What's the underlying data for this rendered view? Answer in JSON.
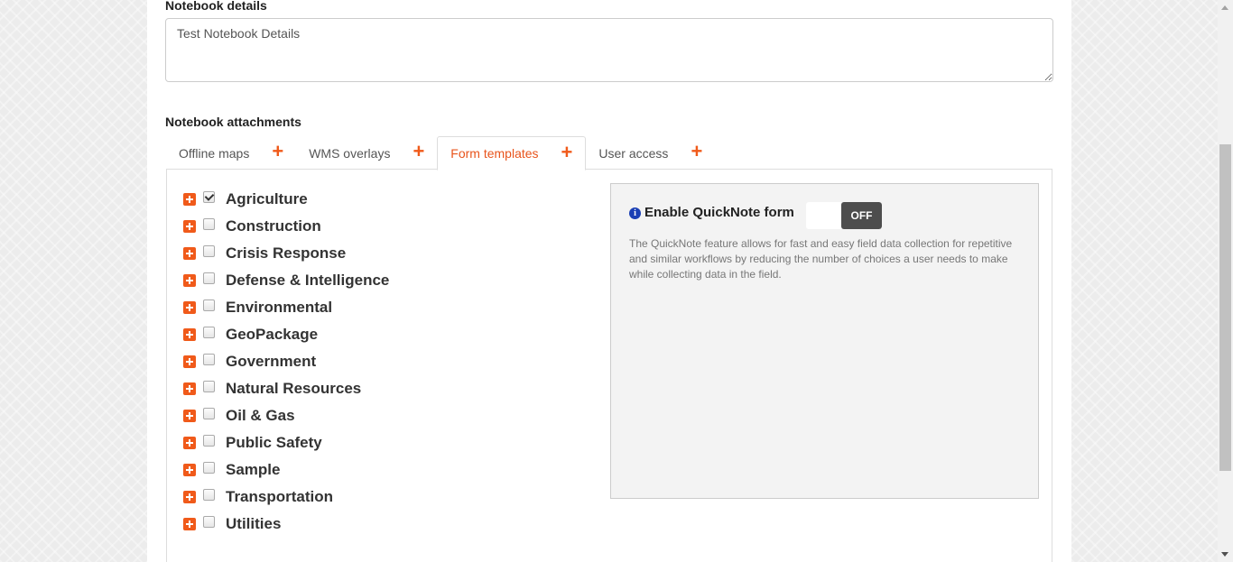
{
  "details": {
    "label": "Notebook details",
    "value": "Test Notebook Details"
  },
  "attachments": {
    "label": "Notebook attachments",
    "tabs": [
      {
        "label": "Offline maps",
        "add_icon": "plus-icon"
      },
      {
        "label": "WMS overlays",
        "add_icon": "plus-icon"
      },
      {
        "label": "Form templates",
        "add_icon": "plus-icon",
        "active": true
      },
      {
        "label": "User access",
        "add_icon": "plus-icon"
      }
    ]
  },
  "templates": [
    {
      "label": "Agriculture",
      "checked": true
    },
    {
      "label": "Construction",
      "checked": false
    },
    {
      "label": "Crisis Response",
      "checked": false
    },
    {
      "label": "Defense & Intelligence",
      "checked": false
    },
    {
      "label": "Environmental",
      "checked": false
    },
    {
      "label": "GeoPackage",
      "checked": false
    },
    {
      "label": "Government",
      "checked": false
    },
    {
      "label": "Natural Resources",
      "checked": false
    },
    {
      "label": "Oil & Gas",
      "checked": false
    },
    {
      "label": "Public Safety",
      "checked": false
    },
    {
      "label": "Sample",
      "checked": false
    },
    {
      "label": "Transportation",
      "checked": false
    },
    {
      "label": "Utilities",
      "checked": false
    }
  ],
  "quicknote": {
    "info_icon": "info-icon",
    "title": "Enable QuickNote form",
    "toggle_label": "OFF",
    "description": "The QuickNote feature allows for fast and easy field data collection for repetitive and similar workflows by reducing the number of choices a user needs to make while collecting data in the field."
  },
  "colors": {
    "accent": "#f05a1a",
    "active_tab": "#e8541c",
    "toggle_off": "#4d4d4d",
    "info": "#1a3fb5"
  }
}
